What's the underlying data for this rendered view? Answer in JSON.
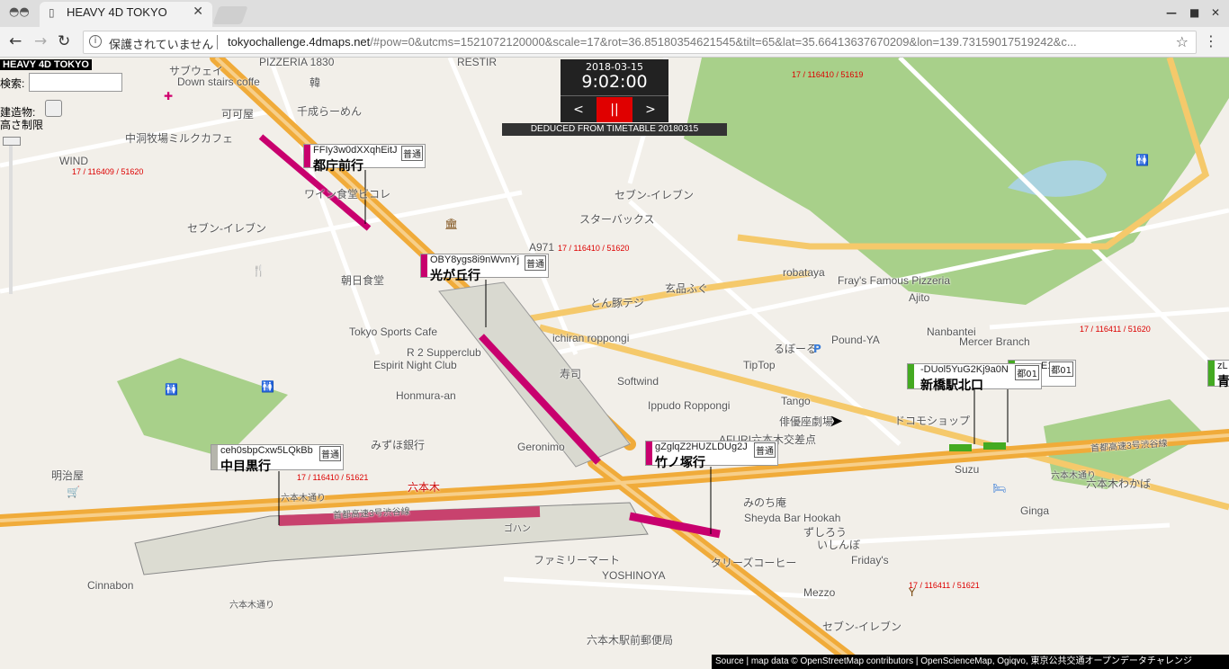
{
  "browser": {
    "tab_title": "HEAVY 4D TOKYO",
    "security": "保護されていません",
    "url_host": "tokyochallenge.4dmaps.net",
    "url_rest": "/#pow=0&utcms=1521072120000&scale=17&rot=36.85180354621545&tilt=65&lat=35.66413637670209&lon=139.73159017519242&c..."
  },
  "app": {
    "title": "HEAVY 4D TOKYO",
    "search_label": "検索:",
    "building_label": "建造物:",
    "height_label": "高さ制限"
  },
  "clock": {
    "date": "2018-03-15",
    "time": "9:02:00",
    "prev": "<",
    "pause": "||",
    "next": ">",
    "deduced": "DEDUCED FROM TIMETABLE 20180315"
  },
  "trains": [
    {
      "id": "FFIy3w0dXXqhEitJ",
      "dest": "都庁前行",
      "type": "普通",
      "color": "#c8006e"
    },
    {
      "id": "OBY8ygs8i9nWvnYj",
      "dest": "光が丘行",
      "type": "普通",
      "color": "#c8006e"
    },
    {
      "id": "gZglqZ2HUZLDUg2J",
      "dest": "竹ノ塚行",
      "type": "普通",
      "color": "#c8006e"
    },
    {
      "id": "ceh0sbpCxw5LQkBb",
      "dest": "中目黒行",
      "type": "普通",
      "color": "#b5b5ac"
    },
    {
      "id": "-DUol5YuG2Kj9a0N",
      "dest": "新橋駅北口",
      "type": "都01",
      "color": "#44aa22"
    },
    {
      "id": "E1",
      "dest": "",
      "type": "都01",
      "color": "#44aa22"
    },
    {
      "id": "zL",
      "dest": "青",
      "type": "",
      "color": "#44aa22"
    }
  ],
  "map_labels": {
    "l1": "サブウェイ",
    "l2": "PIZZERIA 1830",
    "l3": "RESTIR",
    "l4": "Down stairs coffe",
    "l5": "韓",
    "l6": "千成らーめん",
    "l7": "可可屋",
    "l8": "中洞牧場ミルクカフェ",
    "l9": "WIND",
    "l10": "ワイン食堂ビコレ",
    "l11": "セブン-イレブン",
    "l12": "セブン-イレブン",
    "l13": "スターバックス",
    "l14": "A971",
    "l15": "朝日食堂",
    "l16": "robataya",
    "l17": "Fray's Famous Pizzeria",
    "l18": "玄品ふぐ",
    "l19": "とん豚テジ",
    "l20": "Ajito",
    "l21": "Tokyo Sports Cafe",
    "l22": "ichiran roppongi",
    "l23": "Nanbantei",
    "l24": "Mercer Branch",
    "l25": "るぼーる",
    "l26": "Pound-YA",
    "l27": "R 2 Supperclub",
    "l28": "TipTop",
    "l29": "Espirit Night Club",
    "l30": "寿司",
    "l31": "Softwind",
    "l32": "Honmura-an",
    "l33": "Ippudo Roppongi",
    "l34": "Tango",
    "l35": "俳優座劇場",
    "l36": "ドコモショップ",
    "l37": "みずほ銀行",
    "l38": "Geronimo",
    "l39": "AFURI六本木交差点",
    "l40": "明治屋",
    "l41": "六本木",
    "l42": "六本木通り",
    "l43": "首都高速3号渋谷線",
    "l44": "首都高速3号渋谷線",
    "l45": "六本木通り",
    "l46": "Suzu",
    "l47": "六本木わかば",
    "l48": "みのち庵",
    "l49": "Sheyda Bar Hookah",
    "l50": "Ginga",
    "l51": "ずしろう",
    "l52": "いしんぼ",
    "l53": "ファミリーマート",
    "l54": "YOSHINOYA",
    "l55": "タリーズコーヒー",
    "l56": "Friday's",
    "l57": "Cinnabon",
    "l58": "Mezzo",
    "l59": "セブン-イレブン",
    "l60": "六本木駅前郵便局",
    "l61": "ゴハン",
    "l62": "六本木通り"
  },
  "attribution": "Source | map data © OpenStreetMap contributors | OpenScienceMap, Ogiqvo, 東京公共交通オープンデータチャレンジ",
  "colors": {
    "park": "#a8d08a",
    "water": "#aad3df",
    "road": "#f5c96b",
    "highway": "#f0ab3a",
    "subway": "#c8006e"
  }
}
